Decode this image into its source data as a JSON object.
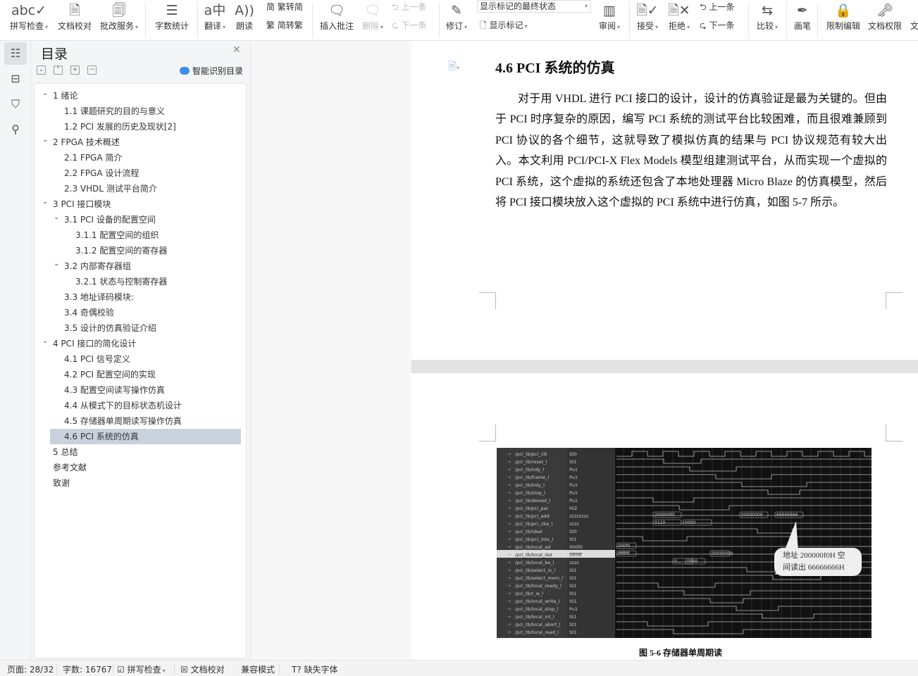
{
  "toolbar": {
    "spell_check": "拼写检查",
    "doc_proof": "文档校对",
    "review_service": "批改服务",
    "word_count": "字数统计",
    "translate": "翻译",
    "read_aloud": "朗读",
    "to_simplified": "繁转简",
    "to_traditional": "简转繁",
    "insert_comment": "插入批注",
    "delete": "删除",
    "prev_comment": "上一条",
    "next_comment": "下一条",
    "track_changes": "修订",
    "markup_mode": "显示标记的最终状态",
    "show_markup": "显示标记",
    "review_pane": "审阅",
    "accept": "接受",
    "reject": "拒绝",
    "prev_change": "上一条",
    "next_change": "下一条",
    "compare": "比较",
    "ink": "画笔",
    "restrict_edit": "限制编辑",
    "doc_permission": "文档权限",
    "more": "文"
  },
  "panel": {
    "title": "目录",
    "smart_toc": "智能识别目录",
    "items": [
      {
        "label": "1  绪论",
        "level": 1,
        "expanded": true
      },
      {
        "label": "1.1 课题研究的目的与意义",
        "level": 2
      },
      {
        "label": "1.2 PCI 发展的历史及现状[2]",
        "level": 2
      },
      {
        "label": "2 FPGA 技术概述",
        "level": 1,
        "expanded": true
      },
      {
        "label": "2.1 FPGA 简介",
        "level": 2
      },
      {
        "label": "2.2 FPGA 设计流程",
        "level": 2
      },
      {
        "label": "2.3 VHDL 测试平台简介",
        "level": 2
      },
      {
        "label": "3 PCI 接口模块",
        "level": 1,
        "expanded": true
      },
      {
        "label": "3.1 PCI 设备的配置空间",
        "level": 2,
        "expanded": true
      },
      {
        "label": "3.1.1  配置空间的组织",
        "level": 3
      },
      {
        "label": "3.1.2  配置空间的寄存器",
        "level": 3
      },
      {
        "label": "3.2  内部寄存器组",
        "level": 2,
        "expanded": true
      },
      {
        "label": "3.2.1 状态与控制寄存器",
        "level": 3
      },
      {
        "label": "3.3  地址译码模块:",
        "level": 2
      },
      {
        "label": "3.4    奇偶校验",
        "level": 2
      },
      {
        "label": "3.5 设计的仿真验证介绍",
        "level": 2
      },
      {
        "label": "4 PCI 接口的简化设计",
        "level": 1,
        "expanded": true
      },
      {
        "label": "4.1 PCI 信号定义",
        "level": 2
      },
      {
        "label": "4.2 PCI 配置空间的实现",
        "level": 2
      },
      {
        "label": "4.3  配置空间读写操作仿真",
        "level": 2
      },
      {
        "label": "4.4  从模式下的目标状态机设计",
        "level": 2
      },
      {
        "label": "4.5  存储器单周期读写操作仿真",
        "level": 2
      },
      {
        "label": "4.6 PCI 系统的仿真",
        "level": 2,
        "selected": true
      },
      {
        "label": "5  总结",
        "level": 1
      },
      {
        "label": "参考文献",
        "level": 1
      },
      {
        "label": "致谢",
        "level": 1
      }
    ]
  },
  "document": {
    "heading": "4.6 PCI 系统的仿真",
    "paragraph": "对于用 VHDL 进行 PCI 接口的设计，设计的仿真验证是最为关键的。但由于 PCI 时序复杂的原因，编写 PCI 系统的测试平台比较困难，而且很难兼顾到 PCI 协议的各个细节，这就导致了模拟仿真的结果与 PCI 协议规范有较大出入。本文利用 PCI/PCI-X Flex Models 模型组建测试平台，从而实现一个虚拟的 PCI 系统，这个虚拟的系统还包含了本地处理器 Micro Blaze 的仿真模型，然后将 PCI 接口模块放入这个虚拟的 PCI 系统中进行仿真，如图 5-7 所示。",
    "figure": {
      "caption": "图 5-6   存储器单周期读",
      "callout": [
        "地址 200000f0H 空",
        "间读出 66666666H"
      ],
      "signals": [
        {
          "name": "/pci_tb/pci_clk",
          "value": "St0"
        },
        {
          "name": "/pci_tb/reset_l",
          "value": "St1"
        },
        {
          "name": "/pci_tb/irdy_l",
          "value": "Pu1"
        },
        {
          "name": "/pci_tb/frame_l",
          "value": "Pu1"
        },
        {
          "name": "/pci_tb/trdy_l",
          "value": "Pu1"
        },
        {
          "name": "/pci_tb/stop_l",
          "value": "Pu1"
        },
        {
          "name": "/pci_tb/devsel_l",
          "value": "Pu1"
        },
        {
          "name": "/pci_tb/pci_par",
          "value": "HiZ"
        },
        {
          "name": "/pci_tb/pci_add",
          "value": "zzzzzzzz"
        },
        {
          "name": "/pci_tb/pci_cbe_l",
          "value": "zzzz"
        },
        {
          "name": "/pci_tb/idsel",
          "value": "St0"
        },
        {
          "name": "/pci_tb/pci_inta_l",
          "value": "St1"
        },
        {
          "name": "/pci_tb/local_ad",
          "value": "000f0"
        },
        {
          "name": "/pci_tb/local_dat",
          "value": "ffffffff"
        },
        {
          "name": "/pci_tb/local_be_l",
          "value": "zzzz"
        },
        {
          "name": "/pci_tb/select_io_l",
          "value": "St1"
        },
        {
          "name": "/pci_tb/select_mem_l",
          "value": "St1"
        },
        {
          "name": "/pci_tb/local_ready_l",
          "value": "St1"
        },
        {
          "name": "/pci_tb/r_w_l",
          "value": "St1"
        },
        {
          "name": "/pci_tb/local_write_l",
          "value": "St1"
        },
        {
          "name": "/pci_tb/local_stop_l",
          "value": "Pu1"
        },
        {
          "name": "/pci_tb/local_int_l",
          "value": "St1"
        },
        {
          "name": "/pci_tb/local_abort_l",
          "value": "St1"
        },
        {
          "name": "/pci_tb/local_read_l",
          "value": "St1"
        }
      ],
      "bus_values": [
        "200000f0",
        "0110",
        "0000",
        "00000000",
        "66666666",
        "000f0",
        "ffffffff",
        "00000000",
        "0...",
        "0000"
      ]
    }
  },
  "status": {
    "page": "页面: 28/32",
    "words": "字数: 16767",
    "spell": "拼写检查",
    "proof": "文档校对",
    "compat": "兼容模式",
    "missing_font": "缺失字体"
  }
}
